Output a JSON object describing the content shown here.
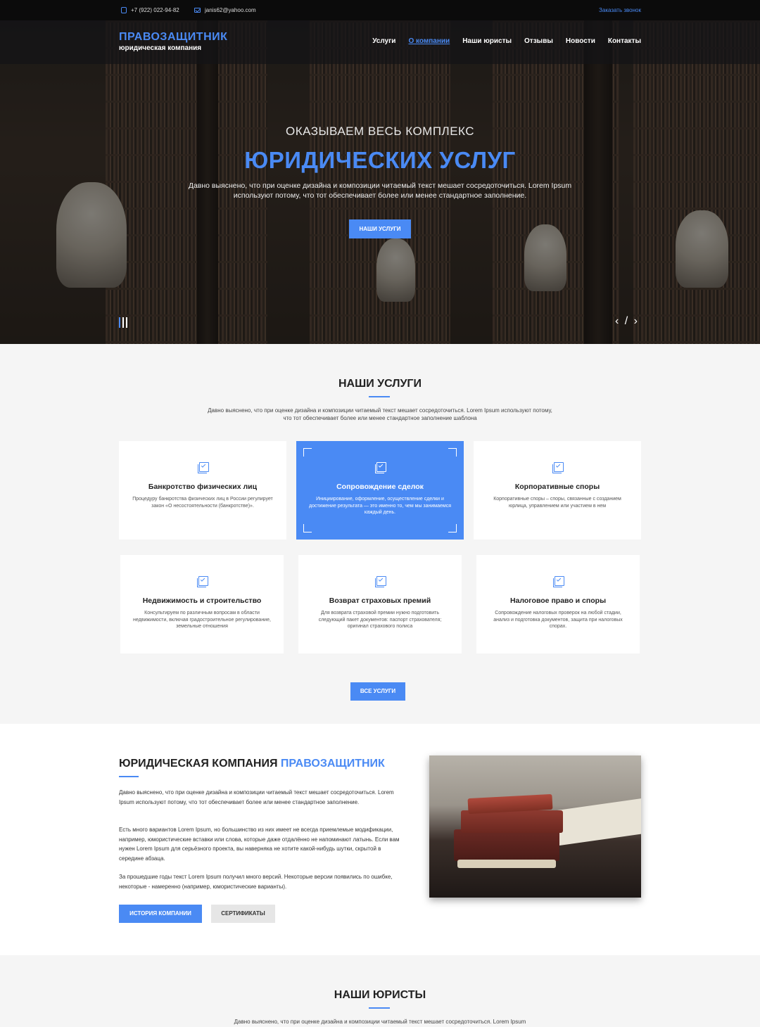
{
  "topbar": {
    "phone": "+7 (922) 022-94-82",
    "email": "janis62@yahoo.com",
    "callback": "Заказать звонок"
  },
  "nav": {
    "logo_title": "ПРАВОЗАЩИТНИК",
    "logo_subtitle": "юридическая компания",
    "items": [
      "Услуги",
      "О компании",
      "Наши юристы",
      "Отзывы",
      "Новости",
      "Контакты"
    ],
    "active_item": "О компании"
  },
  "hero": {
    "pretitle": "ОКАЗЫВАЕМ ВЕСЬ КОМПЛЕКС",
    "title": "ЮРИДИЧЕСКИХ УСЛУГ",
    "description": "Давно выяснено, что при оценке дизайна и композиции читаемый текст мешает сосредоточиться. Lorem Ipsum используют потому, что тот обеспечивает более или менее стандартное заполнение.",
    "button": "НАШИ УСЛУГИ",
    "arrows": "‹ / ›"
  },
  "services": {
    "title": "НАШИ УСЛУГИ",
    "description": "Давно выяснено, что при оценке дизайна и композиции читаемый текст мешает сосредоточиться. Lorem Ipsum используют потому, что тот обеспечивает более или менее стандартное заполнение шаблона",
    "cards": [
      {
        "title": "Банкротство физических лиц",
        "text": "Процедуру банкротства физических лиц в России регулирует закон «О несостоятельности (банкротстве)»."
      },
      {
        "title": "Сопровождение сделок",
        "text": "Инициирование, оформление, осуществление сделки и достижение результата — это именно то, чем мы занимаемся каждый день."
      },
      {
        "title": "Корпоративные споры",
        "text": "Корпоративные споры – споры, связанные с созданием юрлица, управлением или участием в нем"
      },
      {
        "title": "Недвижимость и строительство",
        "text": "Консультируем по различным вопросам в области недвижимости, включая градостроительное регулирование, земельные отношения"
      },
      {
        "title": "Возврат страховых премий",
        "text": "Для возврата страховой премии нужно подготовить следующий пакет документов: паспорт страхователя; оригинал страхового полиса"
      },
      {
        "title": "Налоговое право и споры",
        "text": "Сопровождение налоговых проверок на любой стадии, анализ и подготовка документов, защита при налоговых спорах."
      }
    ],
    "button": "ВСЕ УСЛУГИ"
  },
  "about": {
    "title_prefix": "ЮРИДИЧЕСКАЯ КОМПАНИЯ ",
    "title_highlight": "ПРАВОЗАЩИТНИК",
    "p1": "Давно выяснено, что при оценке дизайна и композиции читаемый текст мешает сосредоточиться. Lorem Ipsum используют потому, что тот обеспечивает более или менее стандартное заполнение.",
    "p2": "Есть много вариантов Lorem Ipsum, но большинство из них имеет не всегда приемлемые модификации, например, юмористические вставки или слова, которые даже отдалённо не напоминают латынь. Если вам нужен Lorem Ipsum для серьёзного проекта, вы наверняка не хотите какой-нибудь шутки, скрытой в середине абзаца.",
    "p3": "За прошедшие годы текст Lorem Ipsum получил много версий. Некоторые версии появились по ошибке, некоторые - намеренно (например, юмористические варианты).",
    "button_history": "ИСТОРИЯ КОМПАНИИ",
    "button_certs": "СЕРТИФИКАТЫ"
  },
  "lawyers": {
    "title": "НАШИ ЮРИСТЫ",
    "description": "Давно выяснено, что при оценке дизайна и композиции читаемый текст мешает сосредоточиться. Lorem Ipsum"
  },
  "colors": {
    "accent": "#4a8af4",
    "topbar": "#0b0b0b",
    "section_bg": "#f5f5f5"
  }
}
